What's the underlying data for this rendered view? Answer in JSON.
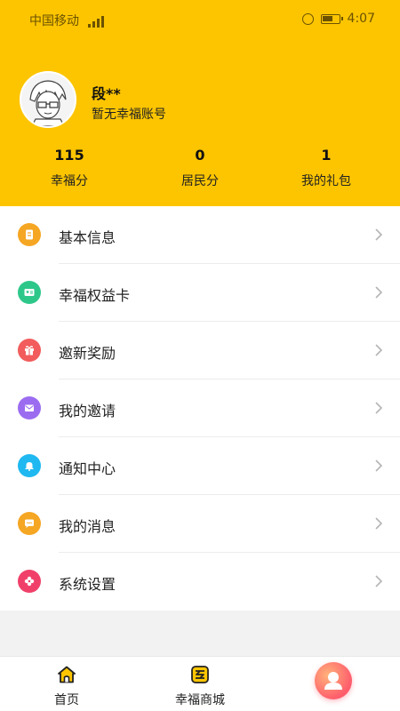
{
  "status_bar": {
    "carrier": "中国移动",
    "time": "4:07"
  },
  "profile": {
    "name": "段**",
    "account_status": "暂无幸福账号"
  },
  "stats": [
    {
      "value": "115",
      "label": "幸福分"
    },
    {
      "value": "0",
      "label": "居民分"
    },
    {
      "value": "1",
      "label": "我的礼包"
    }
  ],
  "menu": [
    {
      "label": "基本信息",
      "icon": "document-icon",
      "color": "#f5a623"
    },
    {
      "label": "幸福权益卡",
      "icon": "id-card-icon",
      "color": "#2ec78a"
    },
    {
      "label": "邀新奖励",
      "icon": "gift-icon",
      "color": "#f25c5c"
    },
    {
      "label": "我的邀请",
      "icon": "mail-icon",
      "color": "#9b6cf0"
    },
    {
      "label": "通知中心",
      "icon": "bell-icon",
      "color": "#1fb8f0"
    },
    {
      "label": "我的消息",
      "icon": "chat-bubble-icon",
      "color": "#f5a623"
    },
    {
      "label": "系统设置",
      "icon": "flower-settings-icon",
      "color": "#f0406a"
    }
  ],
  "nav": [
    {
      "label": "首页",
      "icon": "home-icon"
    },
    {
      "label": "幸福商城",
      "icon": "mall-icon"
    },
    {
      "label": "",
      "icon": "user-icon"
    }
  ],
  "colors": {
    "brand_yellow": "#fdc500",
    "me_gradient": "#ff5d6c"
  }
}
